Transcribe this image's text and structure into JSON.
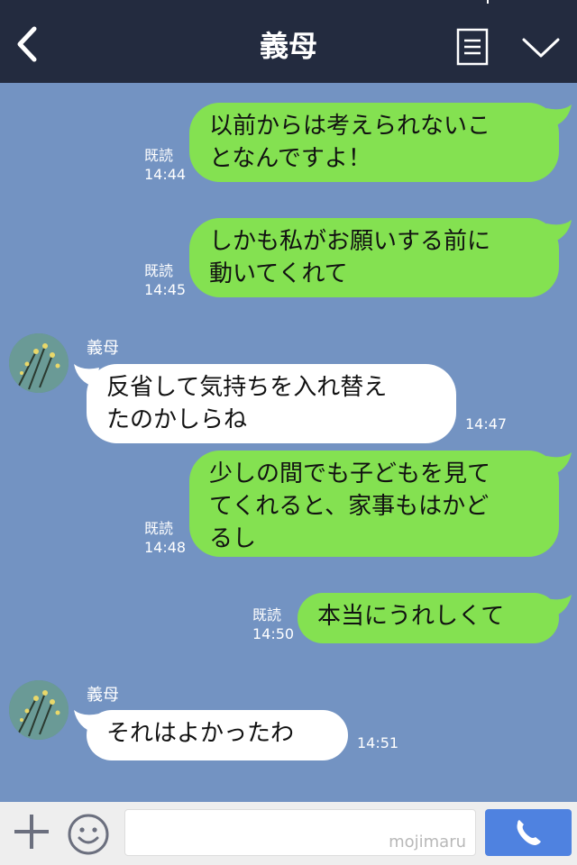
{
  "header": {
    "title": "義母",
    "back_icon": "chevron-left-icon",
    "notes_icon": "notes-icon",
    "menu_icon": "chevron-down-icon",
    "background": "#232b3f"
  },
  "colors": {
    "chat_background": "#7393c2",
    "my_bubble": "#84e151",
    "their_bubble": "#ffffff",
    "call_button": "#4f82e0"
  },
  "messages": [
    {
      "from": "me",
      "text_lines": [
        "以前からは考えられないこ",
        "となんですよ！"
      ],
      "read": "既読",
      "time": "14:44"
    },
    {
      "from": "me",
      "text_lines": [
        "しかも私がお願いする前に",
        "動いてくれて"
      ],
      "read": "既読",
      "time": "14:45"
    },
    {
      "from": "them",
      "sender": "義母",
      "text_lines": [
        "反省して気持ちを入れ替え",
        "たのかしらね"
      ],
      "time": "14:47"
    },
    {
      "from": "me",
      "text_lines": [
        "少しの間でも子どもを見て",
        "てくれると、家事もはかど",
        "るし"
      ],
      "read": "既読",
      "time": "14:48"
    },
    {
      "from": "me",
      "text_lines": [
        "本当にうれしくて"
      ],
      "read": "既読",
      "time": "14:50"
    },
    {
      "from": "them",
      "sender": "義母",
      "text_lines": [
        "それはよかったわ"
      ],
      "time": "14:51"
    }
  ],
  "input": {
    "value": "",
    "watermark": "mojimaru",
    "plus_icon": "plus-icon",
    "emoji_icon": "smiley-icon",
    "call_icon": "phone-icon"
  }
}
